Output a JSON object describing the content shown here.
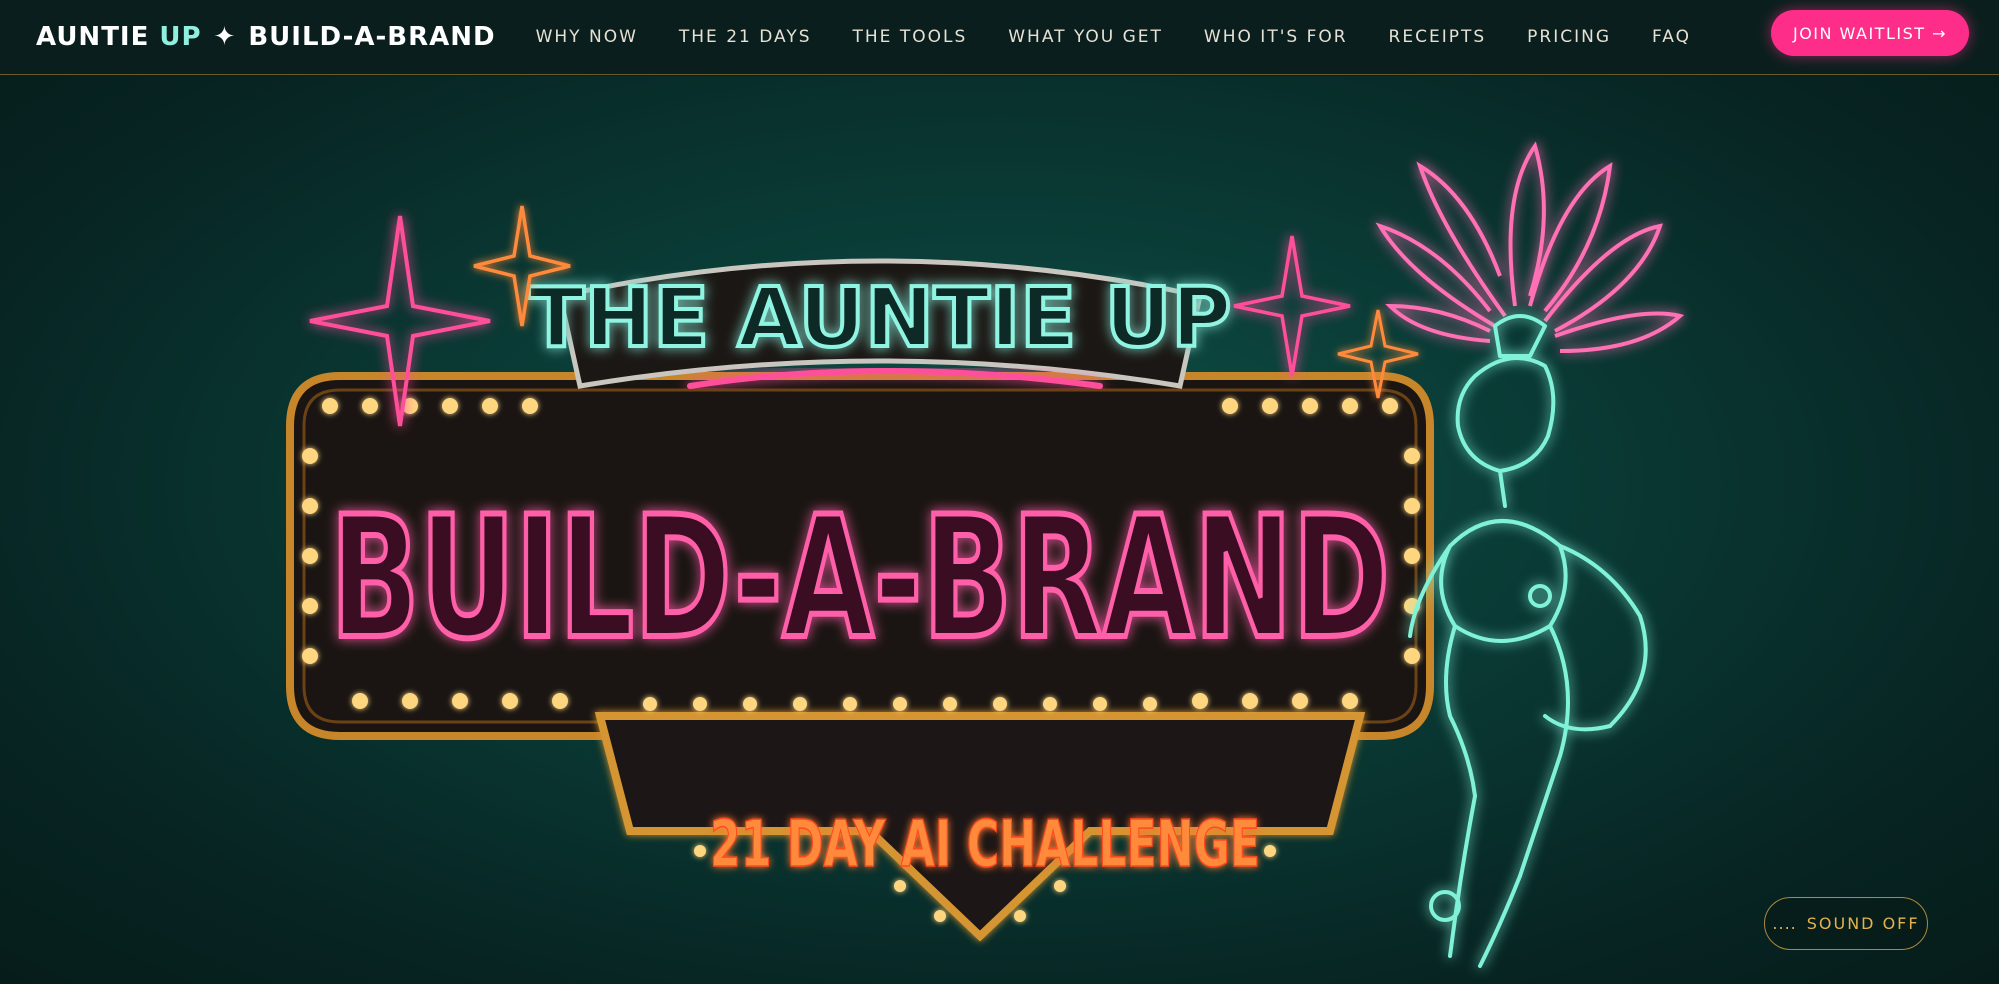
{
  "nav": {
    "brand_part1": "AUNTIE",
    "brand_part2": "UP",
    "brand_star": "✦",
    "brand_part3": "BUILD-A-BRAND",
    "links": [
      "WHY NOW",
      "THE 21 DAYS",
      "THE TOOLS",
      "WHAT YOU GET",
      "WHO IT'S FOR",
      "RECEIPTS",
      "PRICING",
      "FAQ"
    ],
    "cta_label": "JOIN WAITLIST →"
  },
  "hero": {
    "sign_top": "THE AUNTIE UP",
    "sign_main": "BUILD-A-BRAND",
    "sign_sub": "21 DAY AI CHALLENGE"
  },
  "sound": {
    "indicator": "....",
    "label": "SOUND OFF"
  },
  "colors": {
    "accent_pink": "#ff2d8a",
    "accent_mint": "#8ff0df",
    "gold": "#e4b24f",
    "background": "#0a3a35"
  }
}
